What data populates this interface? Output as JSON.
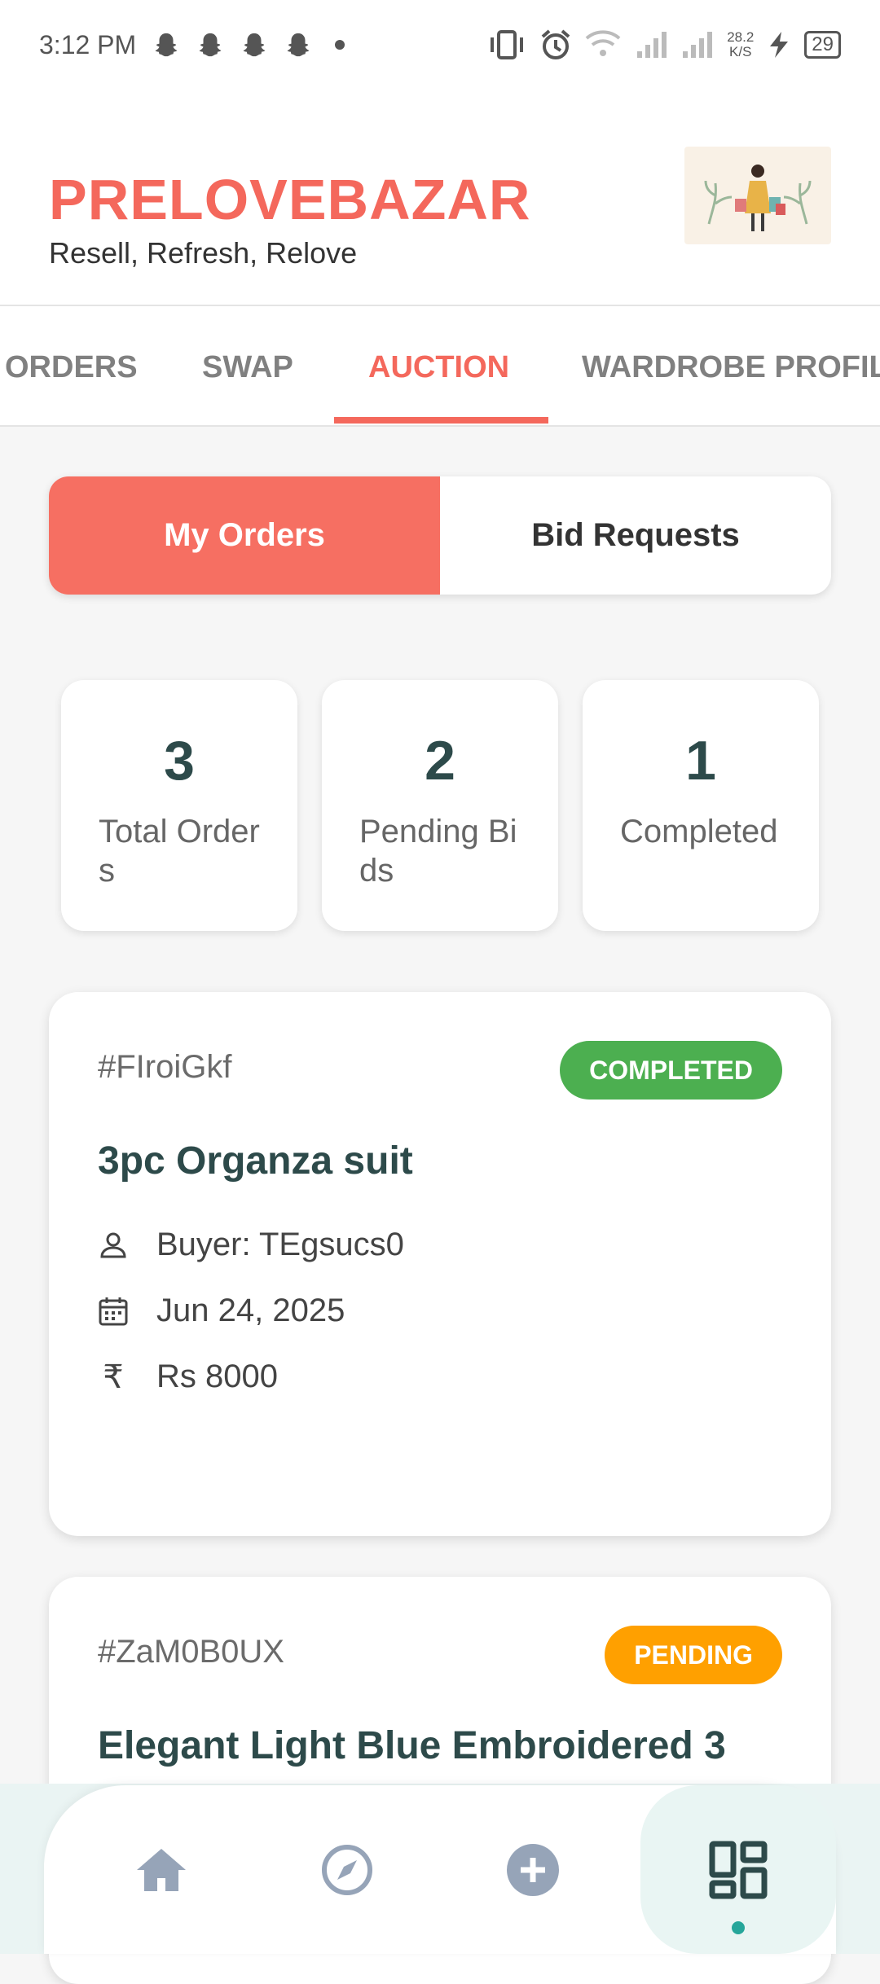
{
  "status_bar": {
    "time": "3:12 PM",
    "notification_icons": [
      "snapchat-icon",
      "snapchat-icon",
      "snapchat-icon",
      "snapchat-icon"
    ],
    "net_speed_value": "28.2",
    "net_speed_unit": "K/S",
    "battery": "29"
  },
  "header": {
    "title": "PRELOVEBAZAR",
    "tagline": "Resell, Refresh, Relove"
  },
  "tabs": [
    {
      "label": "ORDERS"
    },
    {
      "label": "SWAP"
    },
    {
      "label": "AUCTION"
    },
    {
      "label": "WARDROBE PROFILE"
    }
  ],
  "segmented": {
    "my_orders": "My Orders",
    "bid_requests": "Bid Requests"
  },
  "stats": [
    {
      "value": "3",
      "label": "Total Orders"
    },
    {
      "value": "2",
      "label": "Pending Bids"
    },
    {
      "value": "1",
      "label": "Completed"
    }
  ],
  "orders": [
    {
      "id": "#FIroiGkf",
      "status": "COMPLETED",
      "status_color": "#4caf50",
      "title": "3pc Organza suit",
      "buyer": "Buyer: TEgsucs0",
      "date": "Jun 24, 2025",
      "price": "Rs 8000"
    },
    {
      "id": "#ZaM0B0UX",
      "status": "PENDING",
      "status_color": "#ffa000",
      "title": "Elegant Light Blue Embroidered 3"
    }
  ],
  "colors": {
    "accent": "#f4685c",
    "text_dark": "#2d4a4a",
    "nav_active": "#26a69a"
  },
  "bottom_nav": [
    {
      "icon": "home-icon"
    },
    {
      "icon": "compass-icon"
    },
    {
      "icon": "add-circle-icon"
    },
    {
      "icon": "dashboard-icon",
      "active": true
    }
  ]
}
